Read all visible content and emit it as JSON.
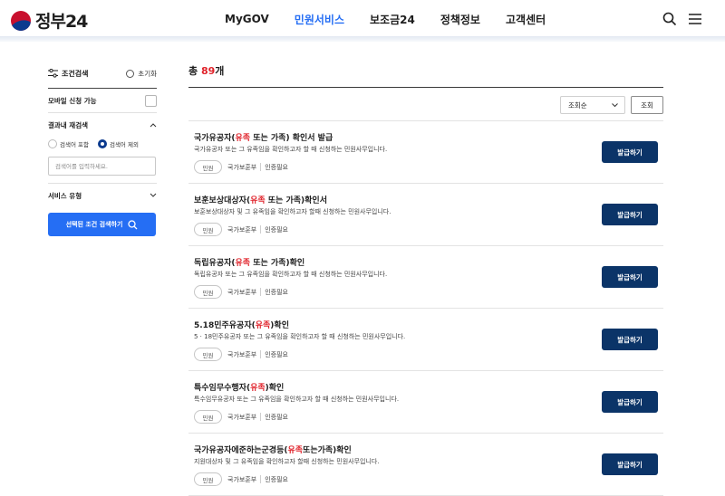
{
  "header": {
    "logo_text": "정부24",
    "nav": [
      "MyGOV",
      "민원서비스",
      "보조금24",
      "정책정보",
      "고객센터"
    ],
    "active_nav": "민원서비스"
  },
  "sidebar": {
    "filter_title": "조건검색",
    "reset_label": "초기화",
    "mobile_label": "모바일 신청 가능",
    "refine_label": "결과내 재검색",
    "radio_include": "검색어 포함",
    "radio_exclude": "검색어 제외",
    "radio_selected": "검색어 제외",
    "search_placeholder": "검색어를 입력하세요.",
    "service_type_label": "서비스 유형",
    "search_button": "선택된 조건 검색하기"
  },
  "main": {
    "total_prefix": "총",
    "total_count": "89",
    "total_suffix": "개",
    "sort_selected": "조회순",
    "sort_button": "조회",
    "action_label": "발급하기",
    "items": [
      {
        "t1": "국가유공자(",
        "hl": "유족",
        "t2": " 또는 가족) 확인서 발급",
        "desc": "국가유공자 또는 그 유족임을 확인하고자 할 때 신청하는 민원사무입니다.",
        "tag": "민원",
        "agency": "국가보훈부",
        "auth": "인증필요"
      },
      {
        "t1": "보훈보상대상자(",
        "hl": "유족",
        "t2": " 또는 가족)확인서",
        "desc": "보훈보상대상자 및 그 유족임을 확인하고자 할때 신청하는 민원사무입니다.",
        "tag": "민원",
        "agency": "국가보훈부",
        "auth": "인증필요"
      },
      {
        "t1": "독립유공자(",
        "hl": "유족",
        "t2": " 또는 가족)확인",
        "desc": "독립유공자 또는 그 유족임을 확인하고자 할 때 신청하는 민원사무입니다.",
        "tag": "민원",
        "agency": "국가보훈부",
        "auth": "인증필요"
      },
      {
        "t1": "5.18민주유공자(",
        "hl": "유족",
        "t2": ")확인",
        "desc": "5 · 18민주유공자 또는 그 유족임을 확인하고자 할 때 신청하는 민원사무입니다.",
        "tag": "민원",
        "agency": "국가보훈부",
        "auth": "인증필요"
      },
      {
        "t1": "특수임무수행자(",
        "hl": "유족",
        "t2": ")확인",
        "desc": "특수임무유공자 또는 그 유족임을 확인하고자 할 때 신청하는 민원사무입니다.",
        "tag": "민원",
        "agency": "국가보훈부",
        "auth": "인증필요"
      },
      {
        "t1": "국가유공자에준하는군경등(",
        "hl": "유족",
        "t2": "또는가족)확인",
        "desc": "지원대상자 및 그 유족임을 확인하고자 할때 신청하는 민원사무입니다.",
        "tag": "민원",
        "agency": "국가보훈부",
        "auth": "인증필요"
      }
    ]
  },
  "colors": {
    "accent": "#256ef4",
    "highlight": "#e0222a",
    "button_dark": "#0b3468"
  }
}
